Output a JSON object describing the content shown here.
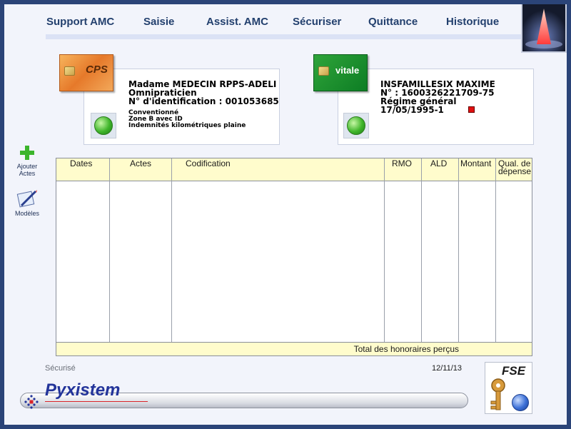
{
  "menu": {
    "items": [
      {
        "label": "Support AMC"
      },
      {
        "label": "Saisie"
      },
      {
        "label": "Assist. AMC"
      },
      {
        "label": "Sécuriser"
      },
      {
        "label": "Quittance"
      },
      {
        "label": "Historique"
      }
    ]
  },
  "cps_card": {
    "card_label": "CPS",
    "line1": "Madame MEDECIN RPPS-ADELI VII",
    "line2": "Omnipraticien",
    "line3": "N° d'identification :  001053685",
    "small1": "Conventionné",
    "small2": "Zone B avec ID",
    "small3": "Indemnités kilométriques plaine"
  },
  "vitale_card": {
    "card_label": "vitale",
    "line1": "INSFAMILLESIX MAXIME",
    "line2": "N° : 1600326221709-75",
    "line3": "Régime général",
    "line4": "17/05/1995-1"
  },
  "toolbar": {
    "add_label_1": "Ajouter",
    "add_label_2": "Actes",
    "models_label": "Modèles"
  },
  "table": {
    "columns": [
      "Dates",
      "Actes",
      "Codification",
      "RMO",
      "ALD",
      "Montant",
      "Qual. de",
      "dépense"
    ],
    "footer_label": "Total des honoraires perçus"
  },
  "status": {
    "state": "Sécurisé",
    "date": "12/11/13"
  },
  "brand": {
    "name": "Pyxistem"
  },
  "fse": {
    "label": "FSE"
  },
  "colors": {
    "menu_text": "#23406e",
    "table_header": "#fffccc",
    "status_green": "#3fb52a",
    "brand_blue": "#23349a"
  }
}
